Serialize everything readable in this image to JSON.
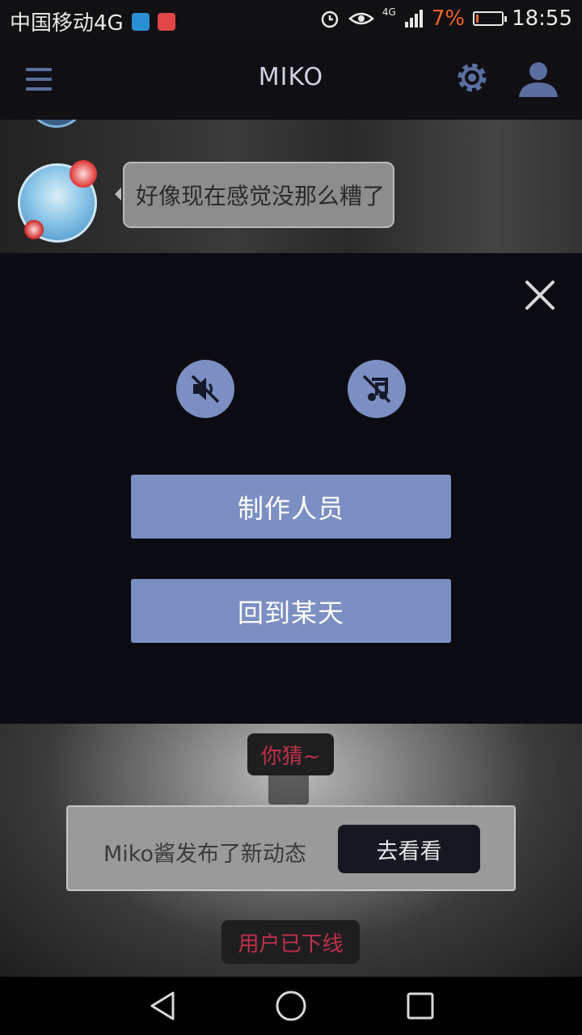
{
  "status_bar": {
    "carrier": "中国移动4G",
    "network_type": "4G",
    "battery_percent": "7%",
    "time": "18:55",
    "icons": [
      "heart-monitor-icon",
      "battery-saver-icon",
      "alarm-icon",
      "eye-icon",
      "signal-icon",
      "battery-icon"
    ]
  },
  "app_bar": {
    "title": "MIKO",
    "icons": [
      "menu-icon",
      "gear-icon",
      "user-icon"
    ]
  },
  "chat": {
    "message": "好像现在感觉没那么糟了"
  },
  "settings_overlay": {
    "icons": [
      "close-icon",
      "sound-off-icon",
      "music-off-icon"
    ],
    "credits_button": "制作人员",
    "back_to_day_button": "回到某天"
  },
  "scene": {
    "guess_chip": "你猜~",
    "notification_text": "Miko酱发布了新动态",
    "notification_button": "去看看",
    "offline_chip": "用户已下线"
  },
  "colors": {
    "accent": "#7b8fc3",
    "status_red": "#c0304a",
    "battery_low": "#f0622a"
  }
}
